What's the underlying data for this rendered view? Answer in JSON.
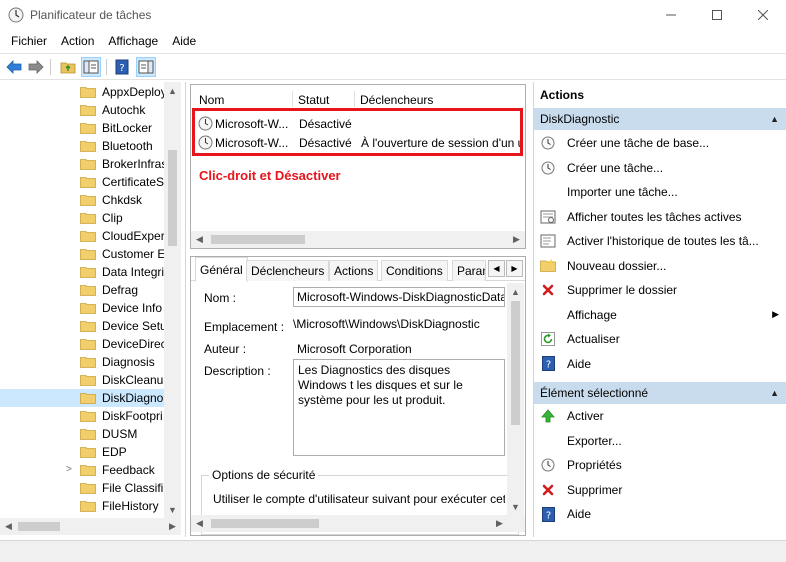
{
  "window": {
    "title": "Planificateur de tâches"
  },
  "menu": [
    "Fichier",
    "Action",
    "Affichage",
    "Aide"
  ],
  "tree": {
    "items": [
      "AppxDeploy",
      "Autochk",
      "BitLocker",
      "Bluetooth",
      "BrokerInfras",
      "CertificateS",
      "Chkdsk",
      "Clip",
      "CloudExper",
      "Customer E",
      "Data Integri",
      "Defrag",
      "Device Info",
      "Device Setu",
      "DeviceDirec",
      "Diagnosis",
      "DiskCleanu",
      "DiskDiagno",
      "DiskFootpri",
      "DUSM",
      "EDP",
      "Feedback",
      "File Classifi",
      "FileHistory"
    ],
    "selected_index": 17,
    "expandable_index": 21
  },
  "task_list": {
    "columns": [
      "Nom",
      "Statut",
      "Déclencheurs"
    ],
    "rows": [
      {
        "name": "Microsoft-W...",
        "status": "Désactivé",
        "trigger": ""
      },
      {
        "name": "Microsoft-W...",
        "status": "Désactivé",
        "trigger": "À l'ouverture de session d'un utilisateur"
      }
    ]
  },
  "annotation": "Clic-droit et Désactiver",
  "details": {
    "tabs": [
      "Général",
      "Déclencheurs",
      "Actions",
      "Conditions",
      "Param"
    ],
    "active_tab": 0,
    "name_label": "Nom :",
    "name_value": "Microsoft-Windows-DiskDiagnosticDataCollector",
    "location_label": "Emplacement :",
    "location_value": "\\Microsoft\\Windows\\DiskDiagnostic",
    "author_label": "Auteur :",
    "author_value": "Microsoft Corporation",
    "description_label": "Description :",
    "description_value": "Les Diagnostics des disques Windows t les disques et sur le système pour les ut produit.",
    "security_group_label": "Options de sécurité",
    "security_text": "Utiliser le compte d'utilisateur suivant pour exécuter cette tâche :"
  },
  "actions": {
    "header": "Actions",
    "section1_title": "DiskDiagnostic",
    "section1_items": [
      {
        "label": "Créer une tâche de base...",
        "icon": "create-basic-task-icon"
      },
      {
        "label": "Créer une tâche...",
        "icon": "create-task-icon"
      },
      {
        "label": "Importer une tâche...",
        "icon": ""
      },
      {
        "label": "Afficher toutes les tâches actives",
        "icon": "running-tasks-icon"
      },
      {
        "label": "Activer l'historique de toutes les tâ...",
        "icon": "history-icon"
      },
      {
        "label": "Nouveau dossier...",
        "icon": "new-folder-icon"
      },
      {
        "label": "Supprimer le dossier",
        "icon": "delete-icon"
      },
      {
        "label": "Affichage",
        "icon": "",
        "submenu": true
      },
      {
        "label": "Actualiser",
        "icon": "refresh-icon"
      },
      {
        "label": "Aide",
        "icon": "help-icon"
      }
    ],
    "section2_title": "Élément sélectionné",
    "section2_items": [
      {
        "label": "Activer",
        "icon": "enable-icon"
      },
      {
        "label": "Exporter...",
        "icon": ""
      },
      {
        "label": "Propriétés",
        "icon": "properties-icon"
      },
      {
        "label": "Supprimer",
        "icon": "delete-icon"
      },
      {
        "label": "Aide",
        "icon": "help-icon"
      }
    ]
  },
  "colors": {
    "accent_red": "#e8141c",
    "section_header": "#c9dced",
    "selection": "#cce8ff"
  }
}
